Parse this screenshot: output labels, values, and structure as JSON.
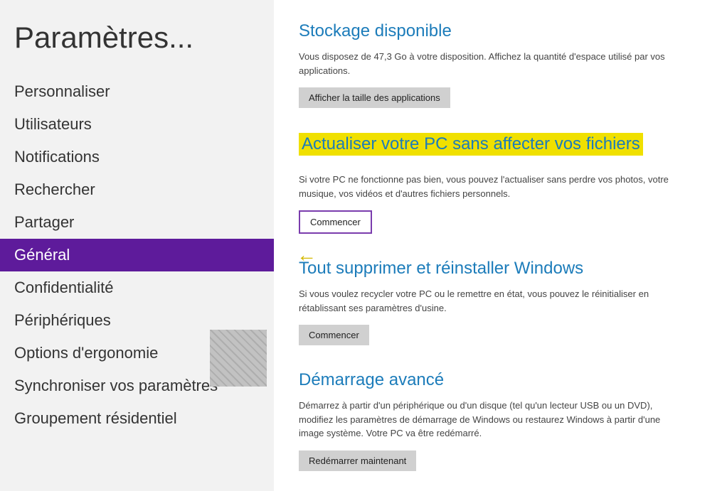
{
  "sidebar": {
    "title": "Paramètres...",
    "items": [
      {
        "id": "personnaliser",
        "label": "Personnaliser",
        "active": false
      },
      {
        "id": "utilisateurs",
        "label": "Utilisateurs",
        "active": false
      },
      {
        "id": "notifications",
        "label": "Notifications",
        "active": false
      },
      {
        "id": "rechercher",
        "label": "Rechercher",
        "active": false
      },
      {
        "id": "partager",
        "label": "Partager",
        "active": false
      },
      {
        "id": "general",
        "label": "Général",
        "active": true
      },
      {
        "id": "confidentialite",
        "label": "Confidentialité",
        "active": false
      },
      {
        "id": "peripheriques",
        "label": "Périphériques",
        "active": false
      },
      {
        "id": "options-ergonomie",
        "label": "Options d'ergonomie",
        "active": false
      },
      {
        "id": "synchroniser",
        "label": "Synchroniser vos paramètres",
        "active": false
      },
      {
        "id": "groupement",
        "label": "Groupement résidentiel",
        "active": false
      }
    ]
  },
  "main": {
    "sections": [
      {
        "id": "stockage",
        "title": "Stockage disponible",
        "highlighted": false,
        "description": "Vous disposez de 47,3 Go à votre disposition. Affichez la quantité d'espace utilisé par vos applications.",
        "button_label": "Afficher la taille des applications",
        "button_style": "default"
      },
      {
        "id": "actualiser",
        "title": "Actualiser votre PC sans affecter vos fichiers",
        "highlighted": true,
        "description": "Si votre PC ne fonctionne pas bien, vous pouvez l'actualiser sans perdre vos photos, votre musique, vos vidéos et d'autres fichiers personnels.",
        "button_label": "Commencer",
        "button_style": "outlined"
      },
      {
        "id": "supprimer",
        "title": "Tout supprimer et réinstaller Windows",
        "highlighted": false,
        "description": "Si vous voulez recycler votre PC ou le remettre en état, vous pouvez le réinitialiser en rétablissant ses paramètres d'usine.",
        "button_label": "Commencer",
        "button_style": "default"
      },
      {
        "id": "demarrage",
        "title": "Démarrage avancé",
        "highlighted": false,
        "description": "Démarrez à partir d'un périphérique ou d'un disque (tel qu'un lecteur USB ou un DVD), modifiez les paramètres de démarrage de Windows ou restaurez Windows à partir d'une image système. Votre PC va être redémarré.",
        "button_label": "Redémarrer maintenant",
        "button_style": "default"
      }
    ]
  }
}
